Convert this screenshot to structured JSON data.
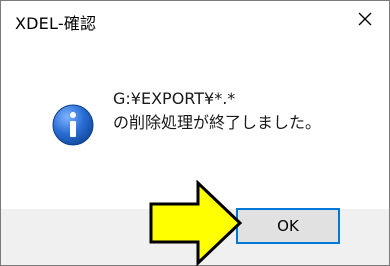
{
  "window": {
    "title": "XDEL-確認",
    "close_icon": "close-icon"
  },
  "message": {
    "icon": "info-icon",
    "line1": "G:¥EXPORT¥*.*",
    "line2": "の削除処理が終了しました。"
  },
  "buttons": {
    "ok_label": "OK"
  },
  "annotation": {
    "arrow_icon": "arrow-right-icon",
    "arrow_color": "#ffff00",
    "arrow_outline": "#000000"
  },
  "colors": {
    "accent": "#0078d7",
    "icon_blue": "#1f5fbf"
  }
}
